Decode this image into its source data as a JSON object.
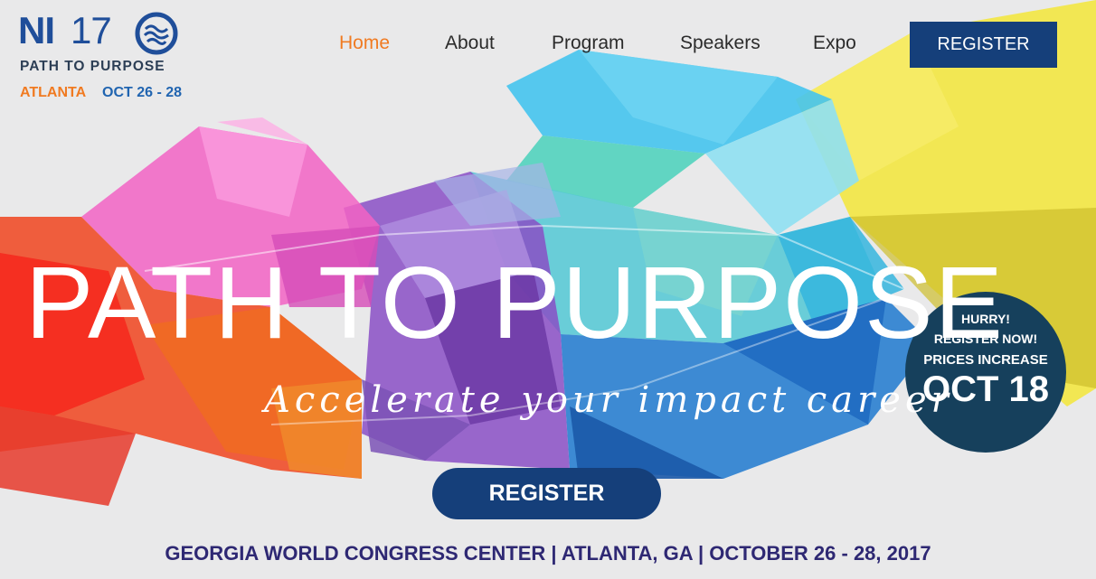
{
  "logo": {
    "event_short": "NI",
    "event_year": "17",
    "tagline": "PATH TO PURPOSE",
    "city": "ATLANTA",
    "dates": "OCT 26 - 28"
  },
  "nav": {
    "items": [
      {
        "label": "Home",
        "active": true
      },
      {
        "label": "About",
        "active": false
      },
      {
        "label": "Program",
        "active": false
      },
      {
        "label": "Speakers",
        "active": false
      },
      {
        "label": "Expo",
        "active": false
      }
    ],
    "register_label": "REGISTER"
  },
  "hero": {
    "title": "PATH TO PURPOSE",
    "subtitle": "Accelerate your impact career",
    "register_label": "REGISTER"
  },
  "badge": {
    "line1": "HURRY!",
    "line2": "REGISTER NOW!",
    "line3": "PRICES INCREASE",
    "line4": "OCT 18"
  },
  "venue": {
    "text": "GEORGIA WORLD CONGRESS CENTER | ATLANTA, GA | OCTOBER 26 - 28, 2017"
  },
  "colors": {
    "accent_orange": "#f07a21",
    "brand_navy": "#153f7a",
    "brand_blue": "#1f4e9a",
    "venue_text": "#2e2873",
    "background": "#e9e9ea"
  }
}
